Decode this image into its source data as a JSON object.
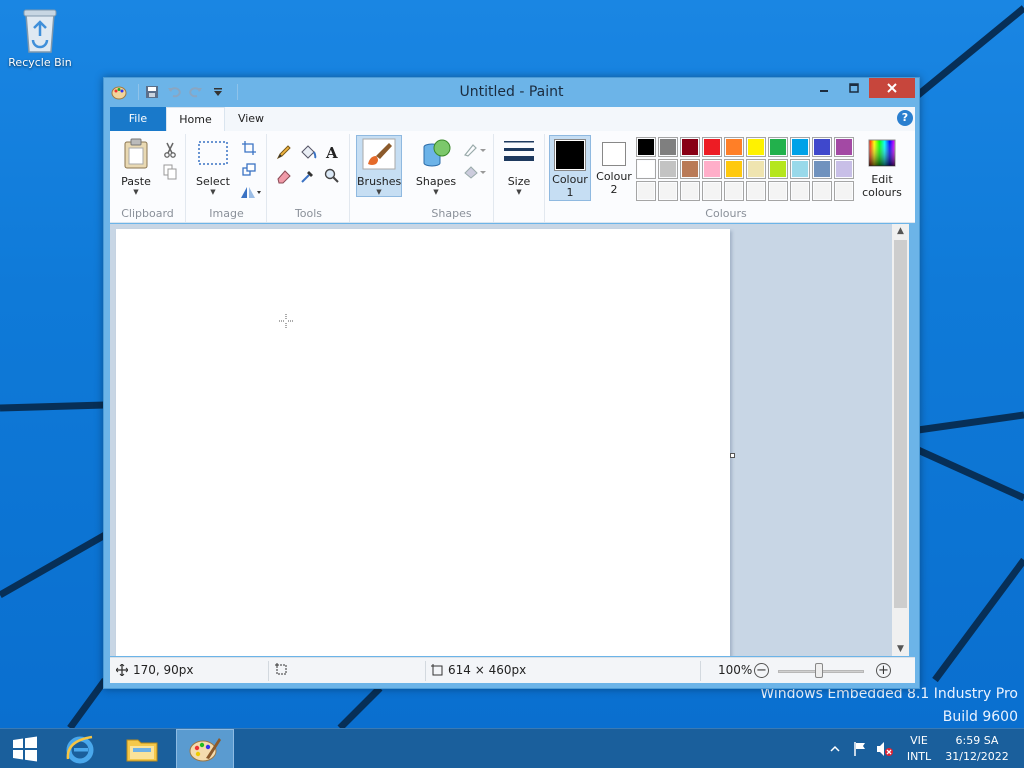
{
  "desktop": {
    "recycle_bin_label": "Recycle Bin",
    "watermark_line1": "Windows Embedded 8.1 Industry Pro",
    "watermark_line2": "Build 9600"
  },
  "window": {
    "title": "Untitled - Paint",
    "tabs": {
      "file": "File",
      "home": "Home",
      "view": "View"
    },
    "help_label": "?"
  },
  "ribbon": {
    "clipboard": {
      "paste": "Paste",
      "group_label": "Clipboard"
    },
    "image": {
      "select": "Select",
      "group_label": "Image"
    },
    "tools": {
      "group_label": "Tools"
    },
    "brushes": {
      "label": "Brushes"
    },
    "shapes": {
      "label": "Shapes",
      "group_label": "Shapes"
    },
    "size": {
      "label": "Size"
    },
    "colours": {
      "colour1_label": "Colour",
      "colour1_num": "1",
      "colour2_label": "Colour",
      "colour2_num": "2",
      "edit_label_1": "Edit",
      "edit_label_2": "colours",
      "group_label": "Colours",
      "colour1_value": "#000000",
      "colour2_value": "#ffffff",
      "palette_row1": [
        "#000000",
        "#7f7f7f",
        "#880015",
        "#ed1c24",
        "#ff7f27",
        "#fff200",
        "#22b14c",
        "#00a2e8",
        "#3f48cc",
        "#a349a4"
      ],
      "palette_row2": [
        "#ffffff",
        "#c3c3c3",
        "#b97a57",
        "#ffaec9",
        "#ffc90e",
        "#efe4b0",
        "#b5e61d",
        "#99d9ea",
        "#7092be",
        "#c8bfe7"
      ],
      "palette_row3": [
        "#f4f4f4",
        "#f4f4f4",
        "#f4f4f4",
        "#f4f4f4",
        "#f4f4f4",
        "#f4f4f4",
        "#f4f4f4",
        "#f4f4f4",
        "#f4f4f4",
        "#f4f4f4"
      ]
    }
  },
  "status": {
    "cursor_pos": "170, 90px",
    "canvas_size": "614 × 460px",
    "zoom": "100%",
    "zoom_level": 100
  },
  "taskbar": {
    "lang_line1": "VIE",
    "lang_line2": "INTL",
    "time": "6:59 SA",
    "date": "31/12/2022"
  }
}
